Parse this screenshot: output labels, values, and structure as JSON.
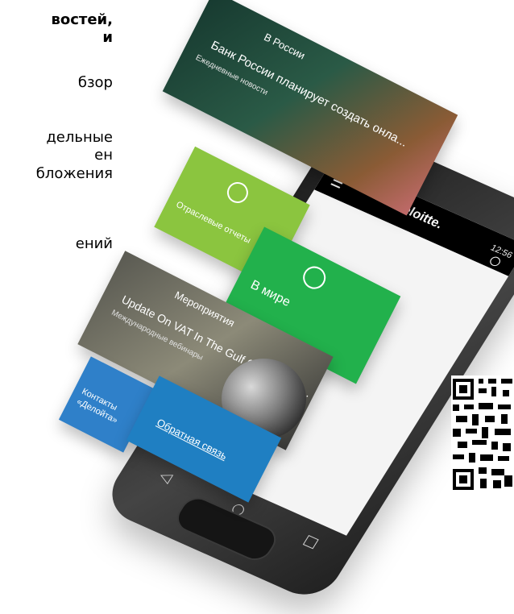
{
  "left_text": {
    "heading_line1": "востей,",
    "heading_line2": "и",
    "line1": "бзор",
    "line2": "дельные",
    "line3": "ен",
    "line4": "бложения",
    "line5": "ений"
  },
  "phone": {
    "brand": "Deloitte.",
    "status": "12:56",
    "nav": {
      "back": "◁",
      "home": "○",
      "recent": "□"
    }
  },
  "cards": {
    "news": {
      "title": "В России",
      "headline": "Банк России планирует создать онла...",
      "subtitle": "Ежедневные новости"
    },
    "reports": {
      "label": "Отраслевые отчеты",
      "icon": "pie-chart-icon"
    },
    "world": {
      "label": "В мире",
      "icon": "globe-icon"
    },
    "events": {
      "title": "Мероприятия",
      "headline": "Update On VAT In The Gulf Cooperation...",
      "subtitle": "Международные вебинары"
    },
    "contacts": {
      "label": "Контакты «Делойта»"
    },
    "feedback": {
      "label": "Обратная связь"
    }
  },
  "colors": {
    "accent_green": "#86BC25",
    "world_green": "#22B14C",
    "blue": "#1F7FC2",
    "black": "#000000"
  }
}
